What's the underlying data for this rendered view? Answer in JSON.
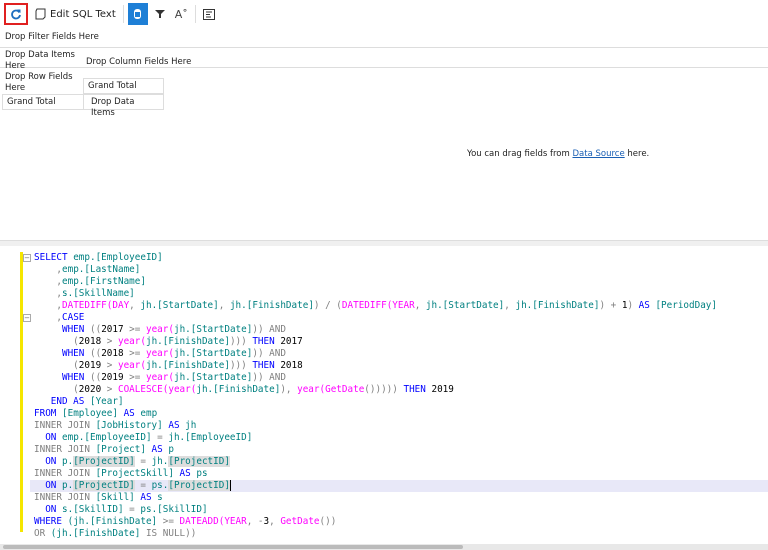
{
  "toolbar": {
    "refresh_icon": "refresh-icon",
    "edit_sql_label": "Edit SQL Text",
    "accent": "#1e7fd6"
  },
  "pivot": {
    "filter_area": "Drop Filter Fields Here",
    "data_items_area": "Drop Data Items Here",
    "column_area": "Drop Column Fields Here",
    "row_area": "Drop Row Fields Here",
    "grand_total_col": "Grand Total",
    "grand_total_row": "Grand Total",
    "drop_data_items": "Drop Data Items"
  },
  "message": {
    "prefix": "You can drag fields from ",
    "link": "Data Source",
    "suffix": " here."
  },
  "code": [
    [
      [
        "SELECT ",
        "k"
      ],
      [
        "emp.[EmployeeID]",
        "i"
      ]
    ],
    [
      [
        "    ,",
        "g"
      ],
      [
        "emp.[LastName]",
        "i"
      ]
    ],
    [
      [
        "    ,",
        "g"
      ],
      [
        "emp.[FirstName]",
        "i"
      ]
    ],
    [
      [
        "    ,",
        "g"
      ],
      [
        "s.[SkillName]",
        "i"
      ]
    ],
    [
      [
        "    ,",
        "g"
      ],
      [
        "DATEDIFF(",
        "f"
      ],
      [
        "DAY",
        "f"
      ],
      [
        ", ",
        "g"
      ],
      [
        "jh.[StartDate]",
        "i"
      ],
      [
        ", ",
        "g"
      ],
      [
        "jh.[FinishDate]",
        "i"
      ],
      [
        ") / (",
        "g"
      ],
      [
        "DATEDIFF(",
        "f"
      ],
      [
        "YEAR",
        "f"
      ],
      [
        ", ",
        "g"
      ],
      [
        "jh.[StartDate]",
        "i"
      ],
      [
        ", ",
        "g"
      ],
      [
        "jh.[FinishDate]",
        "i"
      ],
      [
        ") + ",
        "g"
      ],
      [
        "1",
        "n"
      ],
      [
        ") ",
        "g"
      ],
      [
        "AS ",
        "k"
      ],
      [
        "[PeriodDay]",
        "i"
      ]
    ],
    [
      [
        "    ,",
        "g"
      ],
      [
        "CASE",
        "k"
      ]
    ],
    [
      [
        "     WHEN ",
        "k"
      ],
      [
        "((",
        "g"
      ],
      [
        "2017",
        "n"
      ],
      [
        " >= ",
        "g"
      ],
      [
        "year(",
        "f"
      ],
      [
        "jh.[StartDate]",
        "i"
      ],
      [
        ")) AND",
        "g"
      ]
    ],
    [
      [
        "       (",
        "g"
      ],
      [
        "2018",
        "n"
      ],
      [
        " > ",
        "g"
      ],
      [
        "year(",
        "f"
      ],
      [
        "jh.[FinishDate]",
        "i"
      ],
      [
        "))) ",
        "g"
      ],
      [
        "THEN ",
        "k"
      ],
      [
        "2017",
        "n"
      ]
    ],
    [
      [
        "     WHEN ",
        "k"
      ],
      [
        "((",
        "g"
      ],
      [
        "2018",
        "n"
      ],
      [
        " >= ",
        "g"
      ],
      [
        "year(",
        "f"
      ],
      [
        "jh.[StartDate]",
        "i"
      ],
      [
        ")) AND",
        "g"
      ]
    ],
    [
      [
        "       (",
        "g"
      ],
      [
        "2019",
        "n"
      ],
      [
        " > ",
        "g"
      ],
      [
        "year(",
        "f"
      ],
      [
        "jh.[FinishDate]",
        "i"
      ],
      [
        "))) ",
        "g"
      ],
      [
        "THEN ",
        "k"
      ],
      [
        "2018",
        "n"
      ]
    ],
    [
      [
        "     WHEN ",
        "k"
      ],
      [
        "((",
        "g"
      ],
      [
        "2019",
        "n"
      ],
      [
        " >= ",
        "g"
      ],
      [
        "year(",
        "f"
      ],
      [
        "jh.[StartDate]",
        "i"
      ],
      [
        ")) AND",
        "g"
      ]
    ],
    [
      [
        "       (",
        "g"
      ],
      [
        "2020",
        "n"
      ],
      [
        " > ",
        "g"
      ],
      [
        "COALESCE(",
        "f"
      ],
      [
        "year(",
        "f"
      ],
      [
        "jh.[FinishDate]",
        "i"
      ],
      [
        "), ",
        "g"
      ],
      [
        "year(",
        "f"
      ],
      [
        "GetDate",
        "f"
      ],
      [
        "()))))",
        "g"
      ],
      [
        " THEN ",
        "k"
      ],
      [
        "2019",
        "n"
      ]
    ],
    [
      [
        "   END AS ",
        "k"
      ],
      [
        "[Year]",
        "i"
      ]
    ],
    [
      [
        "FROM ",
        "k"
      ],
      [
        "[Employee]",
        "i"
      ],
      [
        " AS ",
        "k"
      ],
      [
        "emp",
        "i"
      ]
    ],
    [
      [
        "INNER JOIN ",
        "g"
      ],
      [
        "[JobHistory]",
        "i"
      ],
      [
        " AS ",
        "k"
      ],
      [
        "jh",
        "i"
      ]
    ],
    [
      [
        "  ON ",
        "k"
      ],
      [
        "emp.[EmployeeID]",
        "i"
      ],
      [
        " = ",
        "g"
      ],
      [
        "jh.[EmployeeID]",
        "i"
      ]
    ],
    [
      [
        "INNER JOIN ",
        "g"
      ],
      [
        "[Project]",
        "i"
      ],
      [
        " AS ",
        "k"
      ],
      [
        "p",
        "i"
      ]
    ],
    [
      [
        "  ON ",
        "k"
      ],
      [
        "p.",
        "i"
      ],
      [
        "[ProjectID]",
        "i hl"
      ],
      [
        " = ",
        "g"
      ],
      [
        "jh.",
        "i"
      ],
      [
        "[ProjectID]",
        "i hl"
      ]
    ],
    [
      [
        "INNER JOIN ",
        "g"
      ],
      [
        "[ProjectSkill]",
        "i"
      ],
      [
        " AS ",
        "k"
      ],
      [
        "ps",
        "i"
      ]
    ],
    [
      [
        "  ON ",
        "k"
      ],
      [
        "p.",
        "i"
      ],
      [
        "[ProjectID]",
        "i hl"
      ],
      [
        " = ",
        "g"
      ],
      [
        "ps.",
        "i"
      ],
      [
        "[ProjectID]",
        "i hl"
      ]
    ],
    [
      [
        "INNER JOIN ",
        "g"
      ],
      [
        "[Skill]",
        "i"
      ],
      [
        " AS ",
        "k"
      ],
      [
        "s",
        "i"
      ]
    ],
    [
      [
        "  ON ",
        "k"
      ],
      [
        "s.[SkillID]",
        "i"
      ],
      [
        " = ",
        "g"
      ],
      [
        "ps.[SkillID]",
        "i"
      ]
    ],
    [
      [
        "WHERE ",
        "k"
      ],
      [
        "(jh.[FinishDate]",
        "i"
      ],
      [
        " >= ",
        "g"
      ],
      [
        "DATEADD(",
        "f"
      ],
      [
        "YEAR",
        "f"
      ],
      [
        ", -",
        "g"
      ],
      [
        "3",
        "n"
      ],
      [
        ", ",
        "g"
      ],
      [
        "GetDate",
        "f"
      ],
      [
        "())",
        "g"
      ]
    ],
    [
      [
        "OR ",
        "g"
      ],
      [
        "(jh.[FinishDate]",
        "i"
      ],
      [
        " IS NULL))",
        "g"
      ]
    ]
  ]
}
